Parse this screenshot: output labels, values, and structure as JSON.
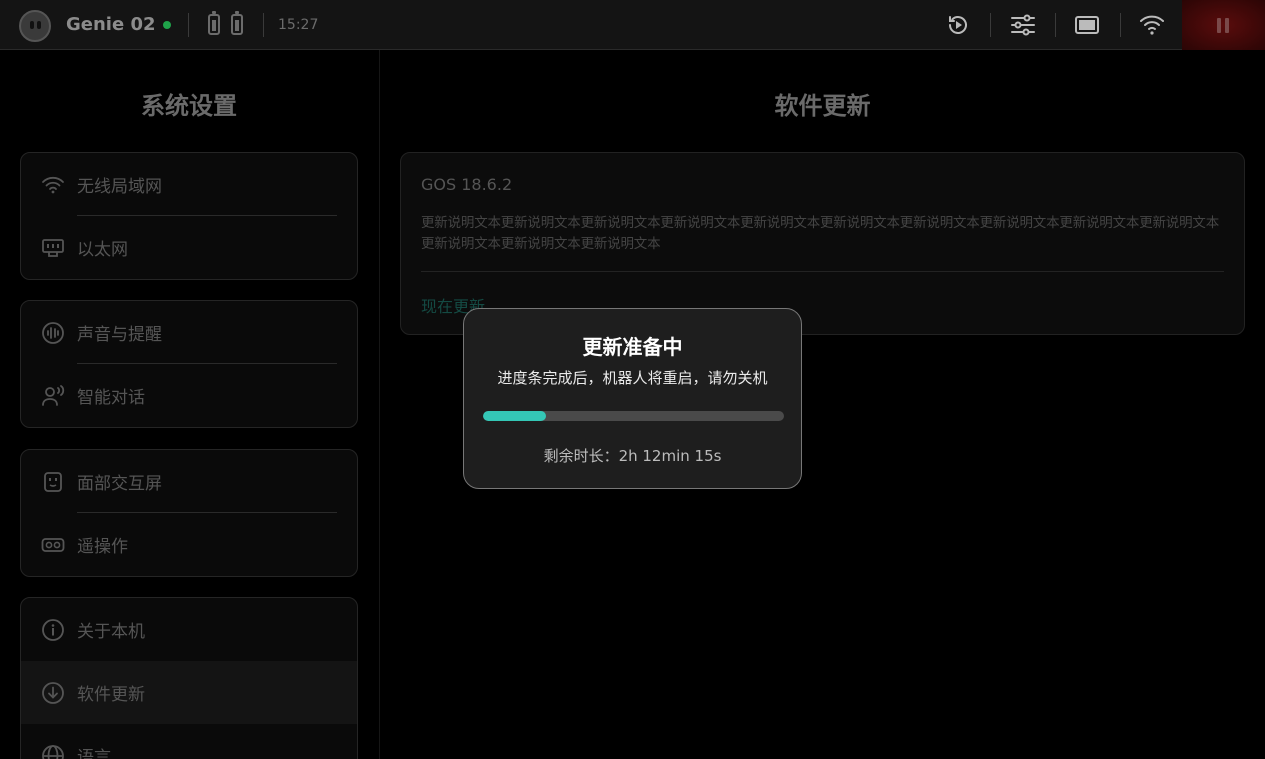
{
  "header": {
    "device_name": "Genie 02",
    "time": "15:27",
    "status_color": "#1fa34a",
    "icons": [
      "robot-face-icon",
      "battery-icon",
      "battery-icon",
      "replay-icon",
      "sliders-icon",
      "screen-icon",
      "wifi-icon",
      "pause-icon"
    ]
  },
  "sidebar": {
    "title": "系统设置",
    "groups": [
      {
        "items": [
          {
            "label": "无线局域网",
            "icon": "wifi-icon"
          },
          {
            "label": "以太网",
            "icon": "ethernet-icon"
          }
        ]
      },
      {
        "items": [
          {
            "label": "声音与提醒",
            "icon": "sound-wave-icon"
          },
          {
            "label": "智能对话",
            "icon": "voice-person-icon"
          }
        ]
      },
      {
        "items": [
          {
            "label": "面部交互屏",
            "icon": "face-screen-icon"
          },
          {
            "label": "遥操作",
            "icon": "vr-headset-icon"
          }
        ]
      },
      {
        "items": [
          {
            "label": "关于本机",
            "icon": "info-icon"
          },
          {
            "label": "软件更新",
            "icon": "download-icon",
            "active": true
          },
          {
            "label": "语言",
            "icon": "globe-icon"
          }
        ]
      }
    ]
  },
  "main": {
    "title": "软件更新",
    "update": {
      "version": "GOS 18.6.2",
      "description": "更新说明文本更新说明文本更新说明文本更新说明文本更新说明文本更新说明文本更新说明文本更新说明文本更新说明文本更新说明文本更新说明文本更新说明文本更新说明文本",
      "action_label": "现在更新"
    }
  },
  "modal": {
    "title": "更新准备中",
    "subtitle": "进度条完成后，机器人将重启，请勿关机",
    "progress_fraction": 0.21,
    "progress_color": "#34c7b6",
    "remaining": "剩余时长：2h 12min 15s"
  }
}
